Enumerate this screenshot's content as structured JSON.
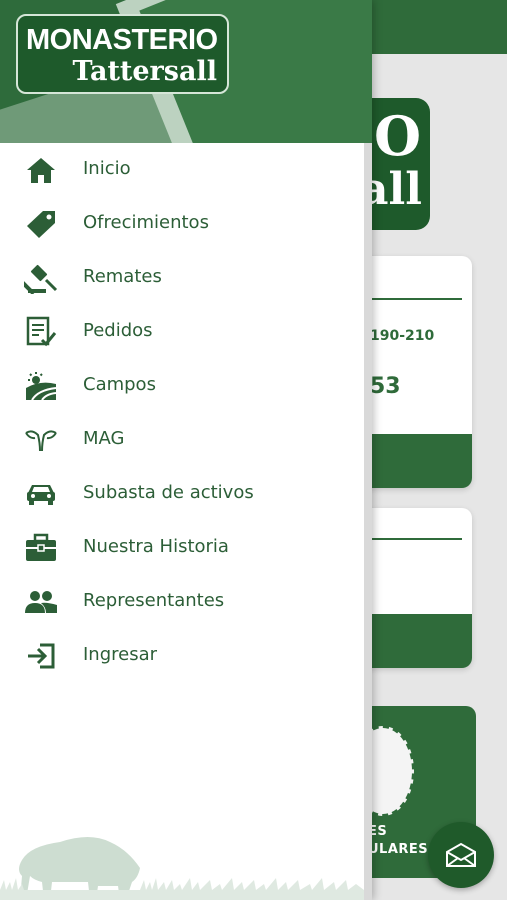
{
  "app": {
    "logo_line1": "MONASTERIO",
    "logo_line2": "Tattersall"
  },
  "colors": {
    "primary": "#2e6b3b",
    "text": "#2c5e37",
    "background": "#ffffff"
  },
  "menu": {
    "items": [
      {
        "label": "Inicio",
        "icon": "home-icon"
      },
      {
        "label": "Ofrecimientos",
        "icon": "tag-icon"
      },
      {
        "label": "Remates",
        "icon": "gavel-icon"
      },
      {
        "label": "Pedidos",
        "icon": "checklist-icon"
      },
      {
        "label": "Campos",
        "icon": "farm-field-icon"
      },
      {
        "label": "MAG",
        "icon": "horns-icon"
      },
      {
        "label": "Subasta de activos",
        "icon": "car-icon"
      },
      {
        "label": "Nuestra Historia",
        "icon": "briefcase-icon"
      },
      {
        "label": "Representantes",
        "icon": "people-icon"
      },
      {
        "label": "Ingresar",
        "icon": "login-icon"
      }
    ]
  },
  "background_screen": {
    "logo_partial_top": "O",
    "logo_partial_bottom": "all",
    "card1_text": "190-210",
    "card1_value": "53",
    "green_card_line1": "ES",
    "green_card_line2": "ULARES"
  }
}
